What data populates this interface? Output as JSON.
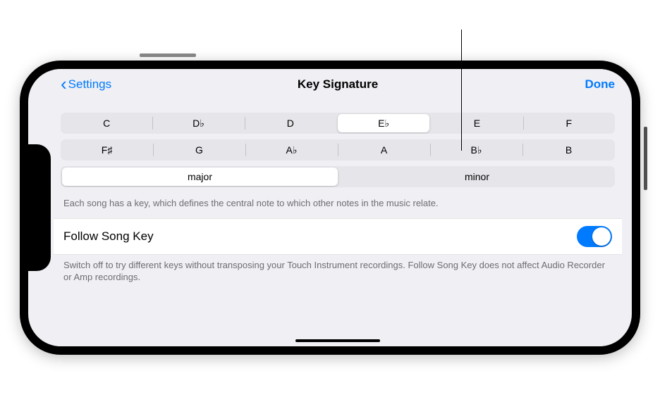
{
  "nav": {
    "back_label": "Settings",
    "title": "Key Signature",
    "done_label": "Done"
  },
  "keys_row1": [
    "C",
    "D♭",
    "D",
    "E♭",
    "E",
    "F"
  ],
  "keys_row2": [
    "F♯",
    "G",
    "A♭",
    "A",
    "B♭",
    "B"
  ],
  "selected_key_index": 3,
  "scales": [
    "major",
    "minor"
  ],
  "selected_scale_index": 0,
  "key_footer": "Each song has a key, which defines the central note to which other notes in the music relate.",
  "follow": {
    "label": "Follow Song Key",
    "on": true,
    "footer": "Switch off to try different keys without transposing your Touch Instrument recordings. Follow Song Key does not affect Audio Recorder or Amp recordings."
  }
}
